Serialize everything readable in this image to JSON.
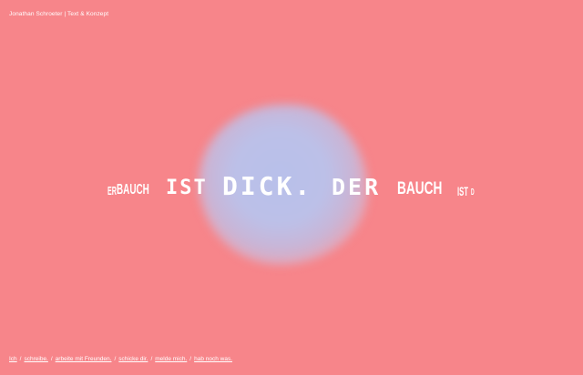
{
  "header": {
    "site_title": "Jonathan Schroeter | Text & Konzept"
  },
  "ticker": {
    "words": [
      "ER",
      "BAUCH",
      "IST",
      "DICK.",
      "DER",
      "BAUCH",
      "IST",
      "D"
    ]
  },
  "nav": {
    "items": [
      "Ich",
      "schreibe.",
      "arbeite mit Freunden.",
      "schicke dir.",
      "melde mich.",
      "hab noch was."
    ],
    "separator": "/"
  },
  "colors": {
    "background": "#f7858a",
    "blob": "#bcc0e8",
    "text": "#ffffff"
  }
}
